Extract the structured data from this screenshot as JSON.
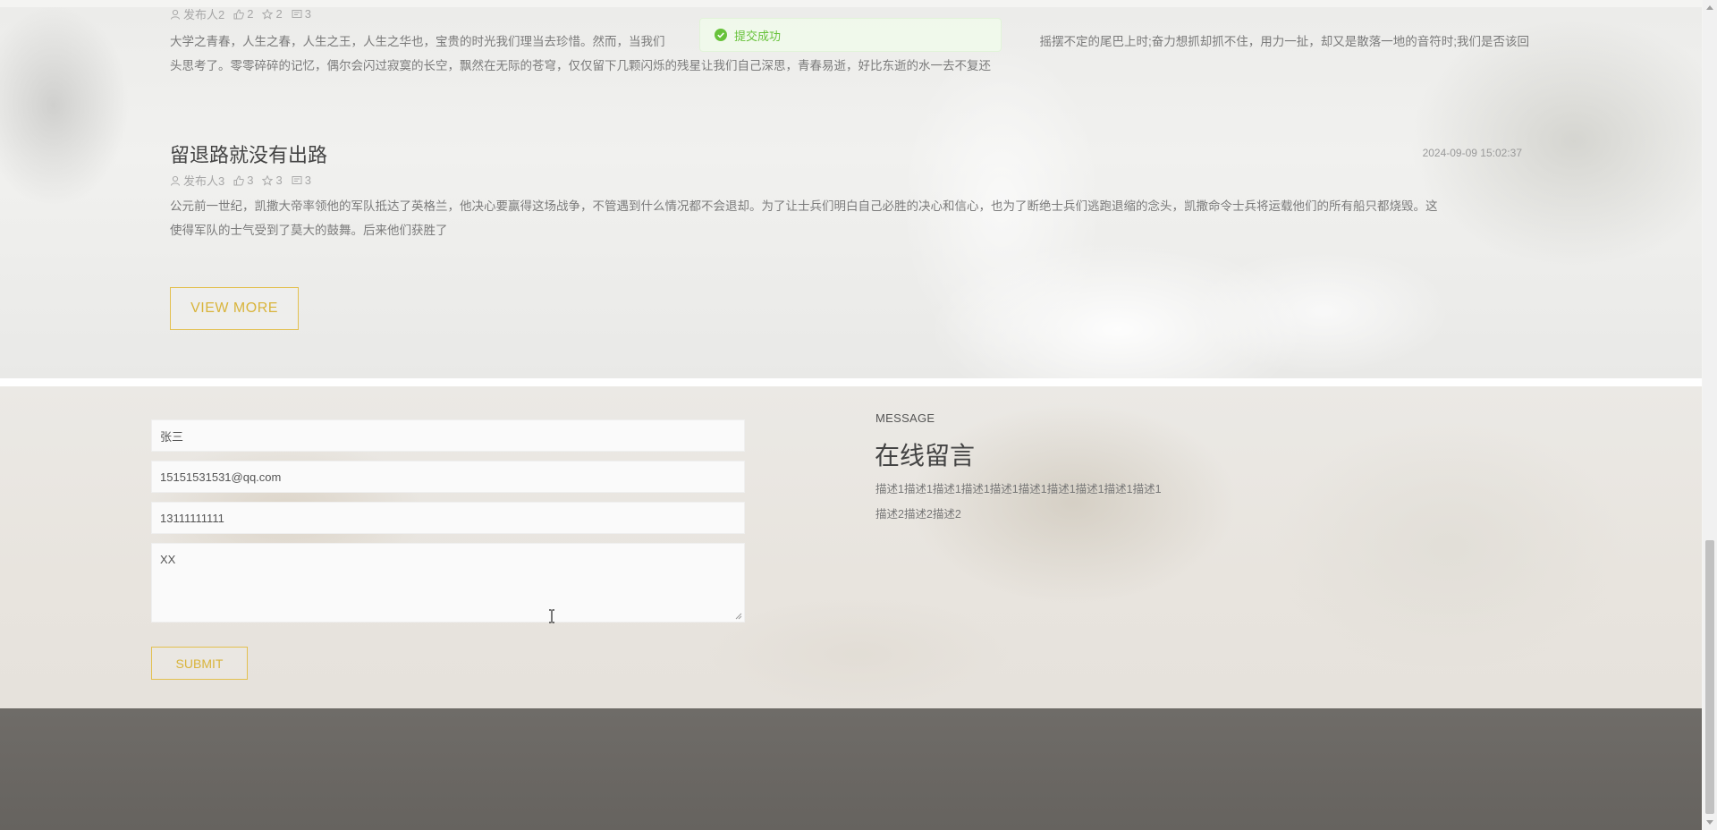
{
  "toast": {
    "text": "提交成功",
    "icon": "check-circle-icon",
    "color": "#67c23a"
  },
  "articles": [
    {
      "title": "",
      "date": "",
      "author": "发布人2",
      "likes": "2",
      "favorites": "2",
      "comments": "3",
      "body_line1": "大学之青春，人生之春，人生之王，人生之华也，宝贵的时光我们理当去珍惜。然而，当我们",
      "body_line1_right": "摇摆不定的尾巴上时;奋力想抓却抓不住，用力一扯，却又是散落一地的音符时;我们是否该回",
      "body_line2": "头思考了。零零碎碎的记忆，偶尔会闪过寂寞的长空，飘然在无际的苍穹，仅仅留下几颗闪烁的残星让我们自己深思，青春易逝，好比东逝的水一去不复还"
    },
    {
      "title": "留退路就没有出路",
      "date": "2024-09-09 15:02:37",
      "author": "发布人3",
      "likes": "3",
      "favorites": "3",
      "comments": "3",
      "body_line1": "公元前一世纪，凯撒大帝率领他的军队抵达了英格兰，他决心要赢得这场战争，不管遇到什么情况都不会退却。为了让士兵们明白自己必胜的决心和信心，也为了断绝士兵们逃跑退缩的念头，凯撒命令士兵将运载他们的所有船只都烧毁。这",
      "body_line2": "使得军队的士气受到了莫大的鼓舞。后来他们获胜了"
    }
  ],
  "view_more": {
    "label": "VIEW MORE"
  },
  "form": {
    "name_value": "张三",
    "email_value": "15151531531@qq.com",
    "phone_value": "13111111111",
    "content_value": "XX",
    "submit_label": "SUBMIT"
  },
  "message": {
    "label": "MESSAGE",
    "title": "在线留言",
    "desc_line1": "描述1描述1描述1描述1描述1描述1描述1描述1描述1描述1",
    "desc_line2": "描述2描述2描述2"
  },
  "colors": {
    "accent": "#e3c04f",
    "footer": "#6b6864"
  },
  "scrollbar": {
    "position_fraction": 0.72
  }
}
